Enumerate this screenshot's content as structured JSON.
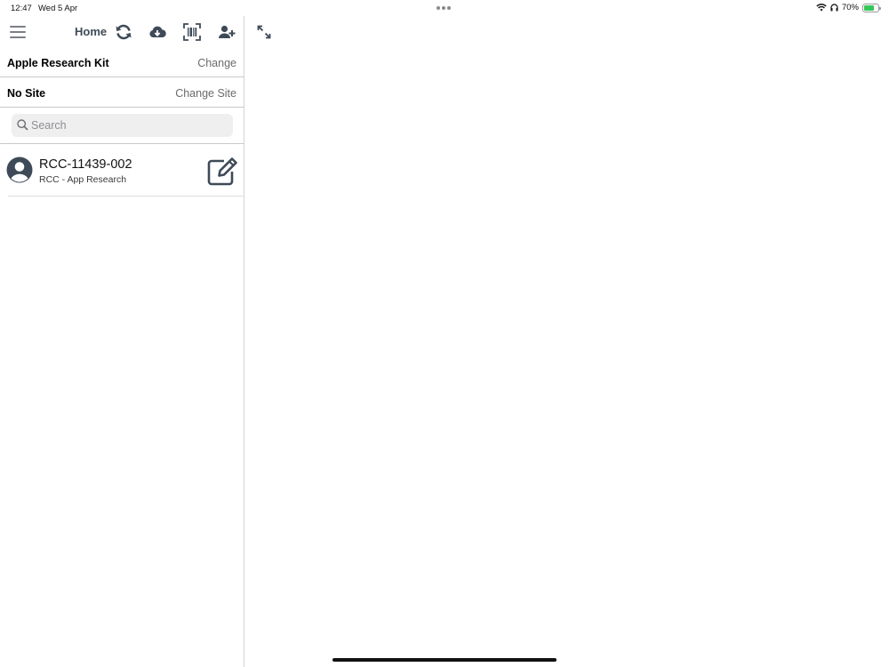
{
  "status_bar": {
    "time": "12:47",
    "date": "Wed 5 Apr",
    "battery_percent": "70%",
    "battery_level": 0.7,
    "icons": [
      "wifi-icon",
      "headphones-icon",
      "battery-icon"
    ]
  },
  "toolbar": {
    "title": "Home",
    "icons": [
      "menu-icon",
      "sync-icon",
      "cloud-download-icon",
      "barcode-scan-icon",
      "add-user-icon"
    ]
  },
  "study": {
    "name": "Apple Research Kit",
    "action": "Change"
  },
  "site": {
    "name": "No Site",
    "action": "Change Site"
  },
  "search": {
    "placeholder": "Search",
    "value": ""
  },
  "participants": [
    {
      "id": "RCC-11439-002",
      "study": "RCC - App Research"
    }
  ],
  "colors": {
    "icon": "#3e4a57",
    "battery": "#35c759"
  }
}
